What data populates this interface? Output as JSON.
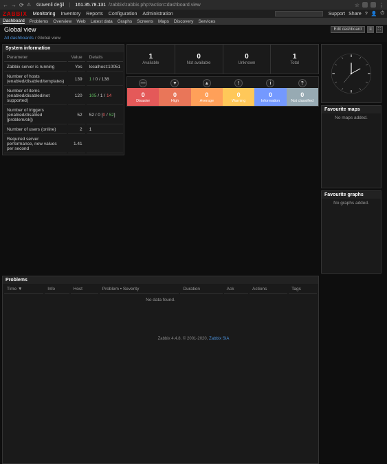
{
  "browser": {
    "tab_title": "Güvenli değil",
    "url_host": "161.35.78.131",
    "url_path": "/zabbix/zabbix.php?action=dashboard.view"
  },
  "logo": "ZABBIX",
  "topnav": {
    "items": [
      "Monitoring",
      "Inventory",
      "Reports",
      "Configuration",
      "Administration"
    ]
  },
  "search_placeholder": "",
  "right_nav": {
    "support": "Support",
    "share": "Share",
    "help": "?"
  },
  "subnav": {
    "items": [
      "Dashboard",
      "Problems",
      "Overview",
      "Web",
      "Latest data",
      "Graphs",
      "Screens",
      "Maps",
      "Discovery",
      "Services"
    ]
  },
  "page_title": "Global view",
  "edit_btn": "Edit dashboard",
  "breadcrumb": {
    "root": "All dashboards",
    "current": "Global view"
  },
  "sysinfo": {
    "title": "System information",
    "headers": {
      "param": "Parameter",
      "value": "Value",
      "details": "Details"
    },
    "rows": [
      {
        "p": "Zabbix server is running",
        "v": "Yes",
        "vcls": "green",
        "d": "localhost:10051"
      },
      {
        "p": "Number of hosts (enabled/disabled/templates)",
        "v": "139",
        "d_html": "<span class='green'>1</span> / <span>0</span> / <span>138</span>"
      },
      {
        "p": "Number of items (enabled/disabled/not supported)",
        "v": "120",
        "d_html": "<span class='green'>105</span> / <span>1</span> / <span class='red'>14</span>"
      },
      {
        "p": "Number of triggers (enabled/disabled [problem/ok])",
        "v": "52",
        "d_html": "52 / 0 [<span class='red'>0</span> / <span class='green'>52</span>]"
      },
      {
        "p": "Number of users (online)",
        "v": "2",
        "d": "1",
        "dcls": "green"
      },
      {
        "p": "Required server performance, new values per second",
        "v": "1.41",
        "d": ""
      }
    ]
  },
  "summary": {
    "cells": [
      {
        "num": "1",
        "lbl": "Available"
      },
      {
        "num": "0",
        "lbl": "Not available"
      },
      {
        "num": "0",
        "lbl": "Unknown"
      },
      {
        "num": "1",
        "lbl": "Total"
      }
    ]
  },
  "severity": {
    "cells": [
      {
        "num": "0",
        "lbl": "Disaster",
        "cls": "sev-disaster",
        "icon": "—"
      },
      {
        "num": "0",
        "lbl": "High",
        "cls": "sev-high",
        "icon": "▼"
      },
      {
        "num": "0",
        "lbl": "Average",
        "cls": "sev-average",
        "icon": "▲"
      },
      {
        "num": "0",
        "lbl": "Warning",
        "cls": "sev-warning",
        "icon": "!"
      },
      {
        "num": "0",
        "lbl": "Information",
        "cls": "sev-info",
        "icon": "i"
      },
      {
        "num": "0",
        "lbl": "Not classified",
        "cls": "sev-unclass",
        "icon": "?"
      }
    ]
  },
  "problems": {
    "title": "Problems",
    "headers": [
      "Time ▼",
      "Info",
      "Host",
      "Problem • Severity",
      "Duration",
      "Ack",
      "Actions",
      "Tags"
    ],
    "nodata": "No data found."
  },
  "fav_maps": {
    "title": "Favourite maps",
    "body": "No maps added."
  },
  "fav_graphs": {
    "title": "Favourite graphs",
    "body": "No graphs added."
  },
  "footer": {
    "text": "Zabbix 4.4.8. © 2001-2020, ",
    "link": "Zabbix SIA"
  }
}
